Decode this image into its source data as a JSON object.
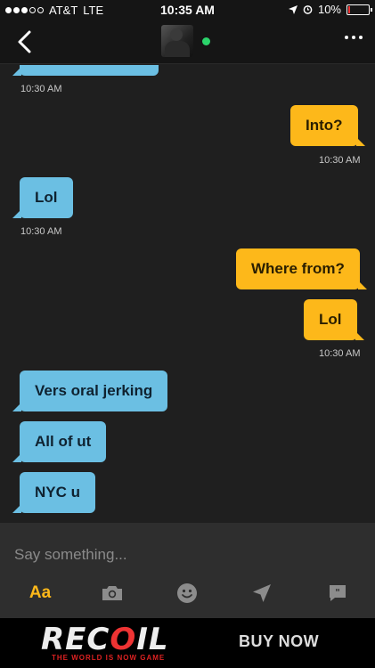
{
  "status_bar": {
    "carrier": "AT&T",
    "network": "LTE",
    "time": "10:35 AM",
    "battery": "10%",
    "battery_level": 0.1,
    "signal_bars": 3
  },
  "header": {
    "online": true,
    "online_color": "#2bd46b"
  },
  "messages": [
    {
      "direction": "in",
      "text": "",
      "timestamp": "10:30 AM"
    },
    {
      "direction": "out",
      "text": "Into?",
      "timestamp": "10:30 AM"
    },
    {
      "direction": "in",
      "text": "Lol",
      "timestamp": "10:30 AM"
    },
    {
      "direction": "out",
      "text": "Where from?",
      "timestamp": ""
    },
    {
      "direction": "out",
      "text": "Lol",
      "timestamp": "10:30 AM"
    },
    {
      "direction": "in",
      "text": "Vers oral jerking",
      "timestamp": ""
    },
    {
      "direction": "in",
      "text": "All of ut",
      "timestamp": ""
    },
    {
      "direction": "in",
      "text": "NYC u",
      "timestamp": ""
    }
  ],
  "composer": {
    "placeholder": "Say something...",
    "text_style_label": "Aa",
    "tools": [
      "text-style-icon",
      "camera-icon",
      "emoji-icon",
      "location-icon",
      "saved-phrases-icon"
    ]
  },
  "ad": {
    "brand_part1": "REC",
    "brand_accent": "O",
    "brand_part2": "IL",
    "tagline": "THE WORLD IS NOW GAME",
    "cta": "BUY NOW"
  },
  "colors": {
    "incoming_bubble": "#6bbfe3",
    "outgoing_bubble": "#fdb81a",
    "background": "#1f1f1f",
    "accent": "#fdb81a"
  }
}
